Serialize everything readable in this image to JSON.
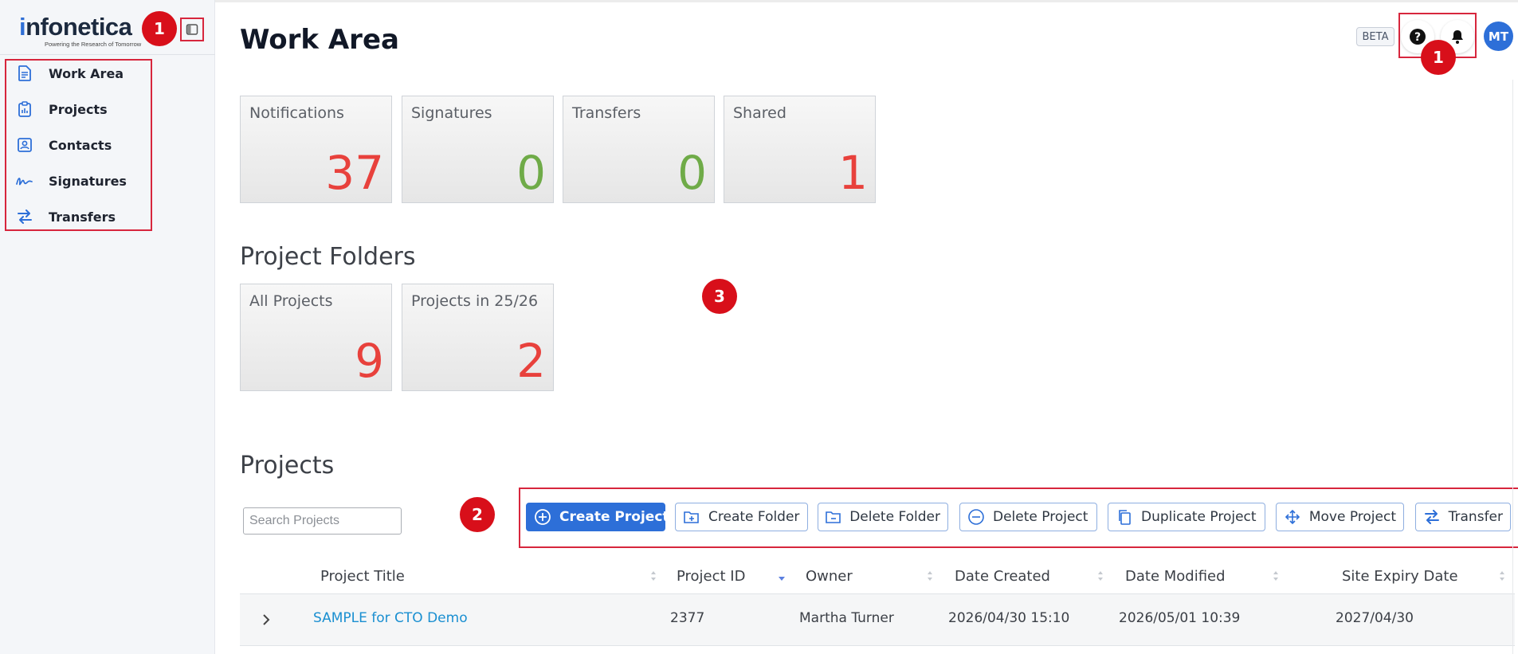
{
  "logo": {
    "text_i": "i",
    "text_rest": "nfonetica",
    "tagline": "Powering the Research of Tomorrow"
  },
  "sidebar": {
    "items": [
      {
        "label": "Work Area",
        "icon": "document-icon"
      },
      {
        "label": "Projects",
        "icon": "clipboard-icon"
      },
      {
        "label": "Contacts",
        "icon": "contact-card-icon"
      },
      {
        "label": "Signatures",
        "icon": "signature-icon"
      },
      {
        "label": "Transfers",
        "icon": "transfer-arrows-icon"
      }
    ]
  },
  "badges": {
    "sidebar_toggle": "1",
    "header": "1",
    "toolbar": "2",
    "folders": "3"
  },
  "header": {
    "title": "Work Area",
    "beta": "BETA",
    "avatar": "MT",
    "help_icon": "help-icon",
    "bell_icon": "bell-icon"
  },
  "summary_tiles": [
    {
      "label": "Notifications",
      "value": "37",
      "color": "#e8413c"
    },
    {
      "label": "Signatures",
      "value": "0",
      "color": "#6fab48"
    },
    {
      "label": "Transfers",
      "value": "0",
      "color": "#6fab48"
    },
    {
      "label": "Shared",
      "value": "1",
      "color": "#e8413c"
    }
  ],
  "project_folders": {
    "title": "Project Folders",
    "tiles": [
      {
        "label": "All Projects",
        "value": "9",
        "color": "#e8413c"
      },
      {
        "label": "Projects in 25/26",
        "value": "2",
        "color": "#e8413c"
      }
    ]
  },
  "projects": {
    "title": "Projects",
    "search_placeholder": "Search Projects",
    "toolbar": [
      {
        "label": "Create Project",
        "icon": "plus-circle-icon"
      },
      {
        "label": "Create Folder",
        "icon": "folder-plus-icon"
      },
      {
        "label": "Delete Folder",
        "icon": "folder-minus-icon"
      },
      {
        "label": "Delete Project",
        "icon": "minus-circle-icon"
      },
      {
        "label": "Duplicate Project",
        "icon": "duplicate-icon"
      },
      {
        "label": "Move Project",
        "icon": "move-icon"
      },
      {
        "label": "Transfer",
        "icon": "transfer-arrows-icon"
      }
    ],
    "columns": [
      "Project Title",
      "Project ID",
      "Owner",
      "Date Created",
      "Date Modified",
      "Site Expiry Date"
    ],
    "rows": [
      {
        "title": "SAMPLE for CTO Demo",
        "id": "2377",
        "owner": "Martha Turner",
        "created": "2026/04/30 15:10",
        "modified": "2026/05/01 10:39",
        "expiry": "2027/04/30"
      }
    ]
  },
  "colors": {
    "accent": "#2d6fd8",
    "annotation_red": "#d80f1a",
    "link": "#1a8fd1"
  }
}
